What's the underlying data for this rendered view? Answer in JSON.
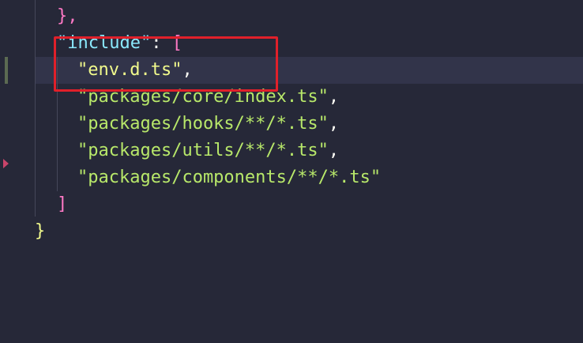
{
  "editor": {
    "lines": [
      {
        "tokens": [
          {
            "text": "},",
            "cls": "punc-p"
          }
        ]
      },
      {
        "tokens": [
          {
            "text": "\"include\"",
            "cls": "key"
          },
          {
            "text": ": ",
            "cls": "punc-w"
          },
          {
            "text": "[",
            "cls": "punc-p"
          }
        ]
      },
      {
        "tokens": [
          {
            "text": "\"env.d.ts\"",
            "cls": "str"
          },
          {
            "text": ",",
            "cls": "punc-w"
          }
        ]
      },
      {
        "tokens": [
          {
            "text": "\"packages/core/index.ts\"",
            "cls": "str-g"
          },
          {
            "text": ",",
            "cls": "punc-w"
          }
        ]
      },
      {
        "tokens": [
          {
            "text": "\"packages/hooks/**/*.ts\"",
            "cls": "str-g"
          },
          {
            "text": ",",
            "cls": "punc-w"
          }
        ]
      },
      {
        "tokens": [
          {
            "text": "\"packages/utils/**/*.ts\"",
            "cls": "str-g"
          },
          {
            "text": ",",
            "cls": "punc-w"
          }
        ]
      },
      {
        "tokens": [
          {
            "text": "\"packages/components/**/*.ts\"",
            "cls": "str-g"
          }
        ]
      },
      {
        "tokens": [
          {
            "text": "]",
            "cls": "punc-p"
          }
        ]
      },
      {
        "tokens": [
          {
            "text": "}",
            "cls": "punc-y"
          }
        ]
      }
    ],
    "colors": {
      "background": "#262838",
      "highlight_border": "#e0202a",
      "key": "#8be9fd",
      "string": "#f1fa8c",
      "bracket": "#ff79c6"
    }
  }
}
